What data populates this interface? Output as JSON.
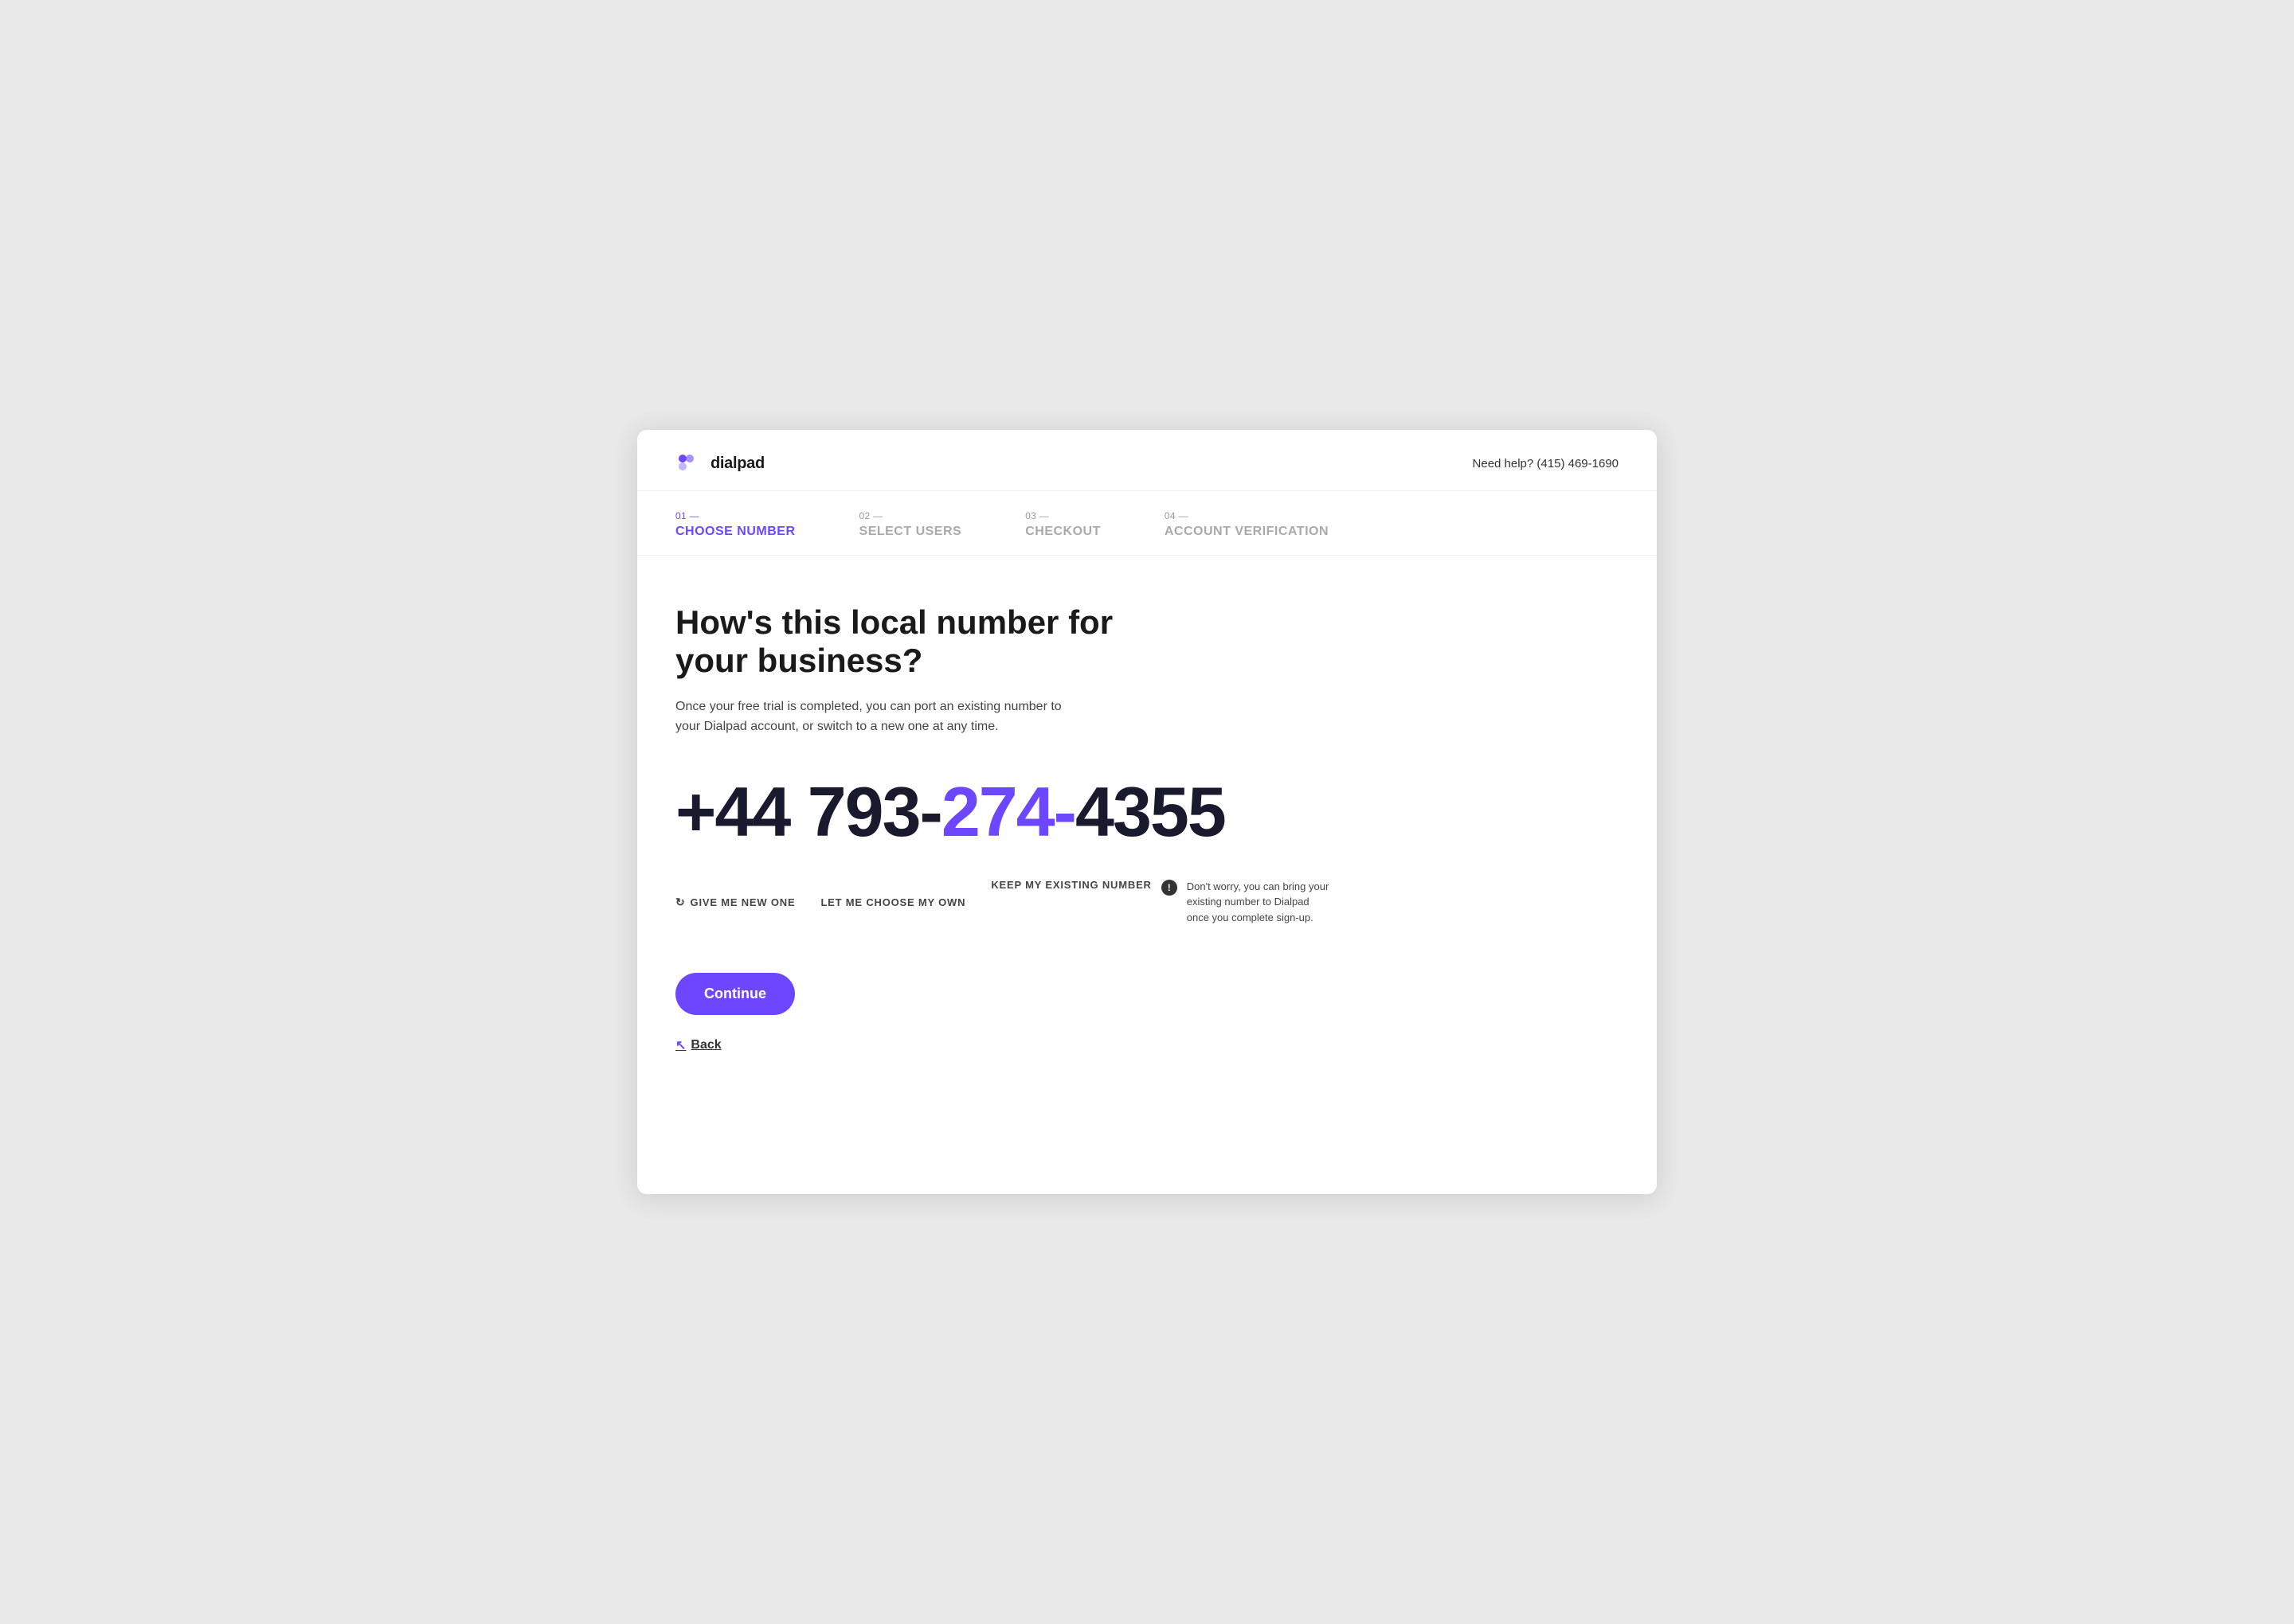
{
  "header": {
    "logo_text": "dialpad",
    "help_text": "Need help?",
    "help_phone": "(415) 469-1690"
  },
  "steps": [
    {
      "id": "choose-number",
      "num": "01 —",
      "label": "CHOOSE NUMBER",
      "active": true
    },
    {
      "id": "select-users",
      "num": "02 —",
      "label": "SELECT USERS",
      "active": false
    },
    {
      "id": "checkout",
      "num": "03 —",
      "label": "CHECKOUT",
      "active": false
    },
    {
      "id": "account-verification",
      "num": "04 —",
      "label": "ACCOUNT VERIFICATION",
      "active": false
    }
  ],
  "main": {
    "headline": "How's this local number for your business?",
    "subtext": "Once your free trial is completed, you can port an existing number to your Dialpad account, or switch to a new one at any time.",
    "phone_number": "+44 793-274-4355",
    "phone_prefix": "+44 793-",
    "phone_highlight": "274-",
    "phone_end": "4355",
    "actions": {
      "give_new": "GIVE ME NEW ONE",
      "choose_own": "LET ME CHOOSE MY OWN",
      "keep_existing": "KEEP MY EXISTING NUMBER",
      "tooltip": "Don't worry, you can bring your existing number to Dialpad once you complete sign-up."
    },
    "continue_label": "Continue",
    "back_label": "Back"
  }
}
